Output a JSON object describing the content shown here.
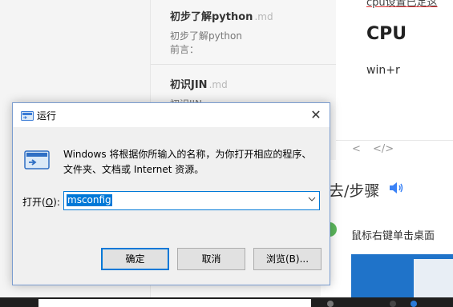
{
  "note_list": {
    "items": [
      {
        "title": "初步了解python",
        "ext": ".md",
        "lines": [
          "初步了解python",
          "前言："
        ]
      },
      {
        "title": "初识JIN",
        "ext": ".md",
        "lines": [
          "初识JIN"
        ]
      }
    ]
  },
  "editor": {
    "cut_text": "cpu设置已定这",
    "heading": "CPU",
    "body": "win+r",
    "toolbar": {
      "prev": "<",
      "code": "</>"
    }
  },
  "article": {
    "step_title": "去/步骤",
    "speaker_icon": "speaker-icon",
    "step_text": "鼠标右键单击桌面"
  },
  "run_dialog": {
    "title": "运行",
    "close": "✕",
    "description": "Windows 将根据你所输入的名称，为你打开相应的程序、文件夹、文档或 Internet 资源。",
    "open_label_prefix": "打开(",
    "open_label_key": "O",
    "open_label_suffix": "):",
    "input_value": "msconfig",
    "buttons": {
      "ok": "确定",
      "cancel": "取消",
      "browse": "浏览(B)..."
    }
  },
  "colors": {
    "accent": "#0078d7",
    "taskbar": "#1f1f1f",
    "dialog_bg": "#f0f0f0"
  }
}
